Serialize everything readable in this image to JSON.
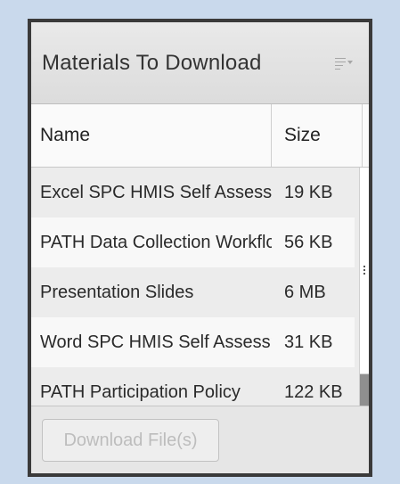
{
  "panel": {
    "title": "Materials To Download",
    "menu_icon": "menu-list-icon"
  },
  "table": {
    "columns": {
      "name": "Name",
      "size": "Size"
    },
    "rows": [
      {
        "name": "Excel SPC HMIS Self Assessmе",
        "size": "19 KB"
      },
      {
        "name": "PATH Data Collection Workflc",
        "size": "56 KB"
      },
      {
        "name": "Presentation Slides",
        "size": "6 MB"
      },
      {
        "name": "Word SPC HMIS Self Assessmе",
        "size": "31 KB"
      },
      {
        "name": "PATH Participation Policy",
        "size": "122 KB"
      }
    ]
  },
  "footer": {
    "download_label": "Download File(s)",
    "download_enabled": false
  },
  "colors": {
    "page_background": "#c9d9ec",
    "panel_border": "#3a3a3a",
    "disabled_text": "#bdbdbd"
  }
}
